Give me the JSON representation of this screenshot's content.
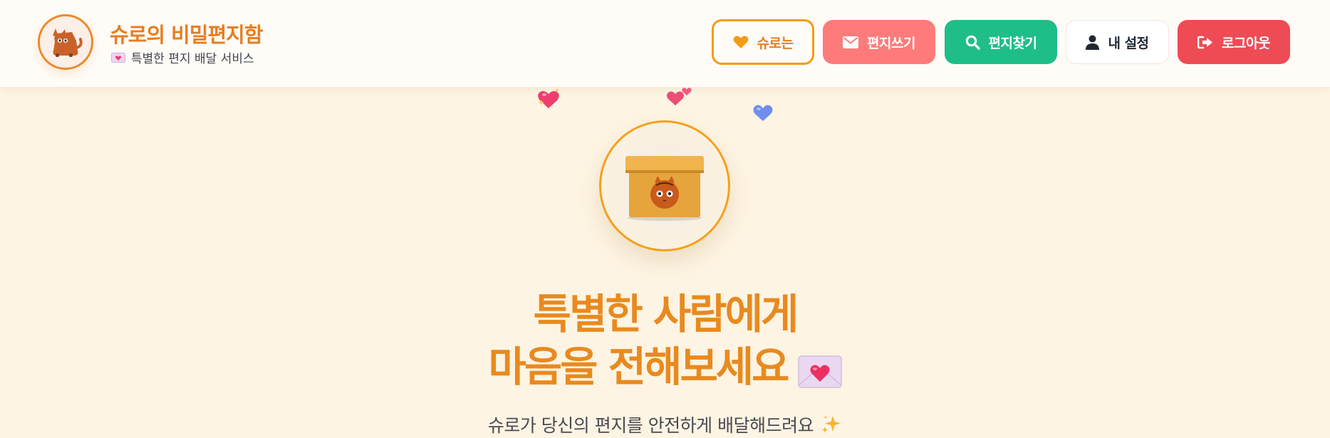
{
  "header": {
    "brand_title": "슈로의 비밀편지함",
    "brand_subtitle": "특별한 편지 배달 서비스",
    "logo_icon": "cat-icon",
    "nav": {
      "about_label": "슈로는",
      "write_label": "편지쓰기",
      "find_label": "편지찾기",
      "settings_label": "내 설정",
      "logout_label": "로그아웃"
    }
  },
  "hero": {
    "title_line1": "특별한 사람에게",
    "title_line2": "마음을 전해보세요",
    "subtitle": "슈로가 당신의 편지를 안전하게 배달해드려요",
    "box_icon": "cat-in-box-icon",
    "floating_icons": [
      "heart-sparkle-icon",
      "twin-hearts-icon",
      "blue-heart-icon"
    ]
  },
  "colors": {
    "accent_orange": "#e67e22",
    "write_button": "#ff7b7b",
    "find_button": "#1fbe88",
    "logout_button": "#ee4b55",
    "page_background": "#fdf4e3"
  }
}
